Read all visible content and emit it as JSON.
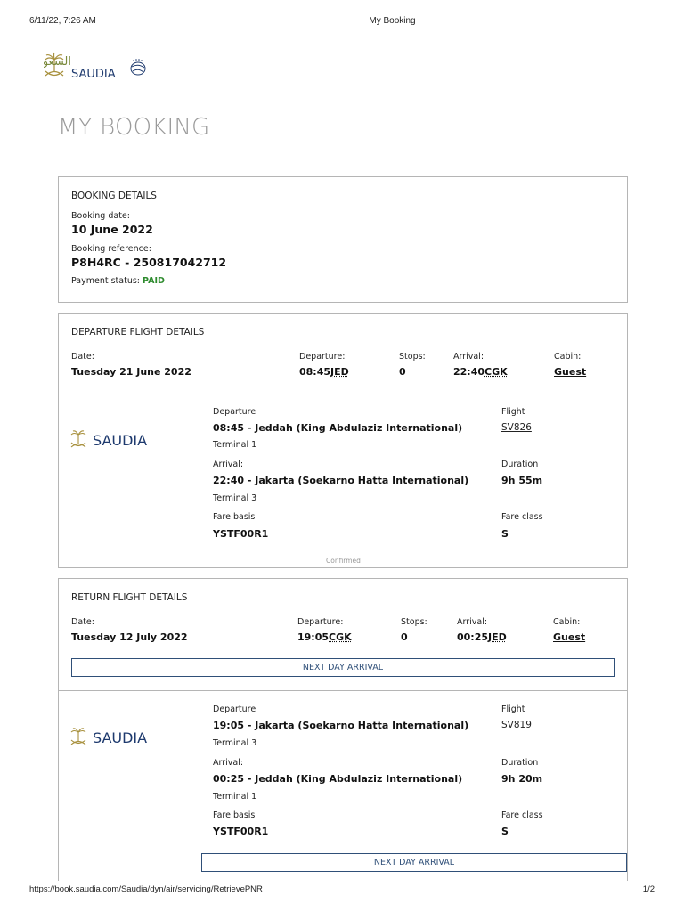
{
  "print": {
    "date": "6/11/22, 7:26 AM",
    "title": "My Booking",
    "url": "https://book.saudia.com/Saudia/dyn/air/servicing/RetrievePNR",
    "page": "1/2"
  },
  "brand": {
    "name_ar": "السعودية",
    "name_en": "SAUDIA",
    "colors": {
      "green": "#7a8a3c",
      "navy": "#1e3a6e",
      "gold": "#a8913e"
    }
  },
  "page_title": "MY BOOKING",
  "booking": {
    "title": "BOOKING DETAILS",
    "date_label": "Booking date:",
    "date": "10 June 2022",
    "reference_label": "Booking reference:",
    "reference": "P8H4RC - 250817042712",
    "payment_label": "Payment status:",
    "payment_status": "PAID"
  },
  "departure": {
    "title": "DEPARTURE FLIGHT DETAILS",
    "date_label": "Date:",
    "date": "Tuesday 21 June 2022",
    "departure_label": "Departure:",
    "departure_time": "08:45",
    "departure_code": "JED",
    "stops_label": "Stops:",
    "stops": "0",
    "arrival_label": "Arrival:",
    "arrival_time": "22:40",
    "arrival_code": "CGK",
    "cabin_label": "Cabin:",
    "cabin": "Guest",
    "segment": {
      "dep_label": "Departure",
      "dep_line": "08:45  -  Jeddah (King Abdulaziz International)",
      "dep_terminal": "Terminal  1",
      "arr_label": "Arrival:",
      "arr_line": "22:40  -  Jakarta (Soekarno Hatta International)",
      "arr_terminal": "Terminal  3",
      "fare_basis_label": "Fare basis",
      "fare_basis": "YSTF00R1",
      "flight_label": "Flight",
      "flight": "SV826",
      "duration_label": "Duration",
      "duration": "9h 55m",
      "fare_class_label": "Fare class",
      "fare_class": "S",
      "status": "Confirmed"
    }
  },
  "return": {
    "title": "RETURN FLIGHT DETAILS",
    "date_label": "Date:",
    "date": "Tuesday 12 July 2022",
    "departure_label": "Departure:",
    "departure_time": "19:05",
    "departure_code": "CGK",
    "stops_label": "Stops:",
    "stops": "0",
    "arrival_label": "Arrival:",
    "arrival_time": "00:25",
    "arrival_code": "JED",
    "cabin_label": "Cabin:",
    "cabin": "Guest",
    "next_day": "NEXT DAY ARRIVAL",
    "segment": {
      "dep_label": "Departure",
      "dep_line": "19:05  -  Jakarta (Soekarno Hatta International)",
      "dep_terminal": "Terminal  3",
      "arr_label": "Arrival:",
      "arr_line": "00:25  -  Jeddah (King Abdulaziz International)",
      "arr_terminal": "Terminal  1",
      "fare_basis_label": "Fare basis",
      "fare_basis": "YSTF00R1",
      "flight_label": "Flight",
      "flight": "SV819",
      "duration_label": "Duration",
      "duration": "9h 20m",
      "fare_class_label": "Fare class",
      "fare_class": "S",
      "next_day": "NEXT DAY ARRIVAL"
    }
  }
}
